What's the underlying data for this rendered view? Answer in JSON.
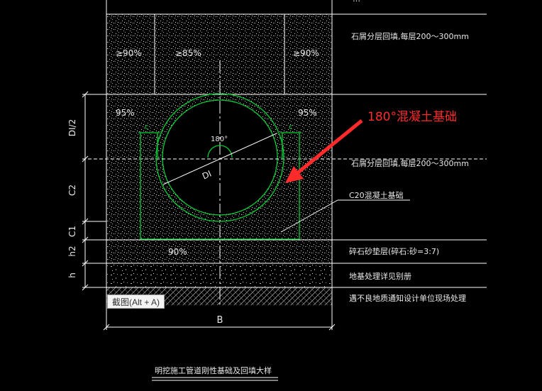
{
  "colors": {
    "background": "#000000",
    "lines": "#ffffff",
    "pipe": "#00cc33",
    "annotation": "#ff2a2a",
    "fill": "#cfcfcf"
  },
  "zones": {
    "upper_left": "≥90%",
    "upper_center": "≥85%",
    "upper_right": "≥90%",
    "pipe_left": "95%",
    "pipe_right": "95%",
    "cushion": "90%"
  },
  "pipe": {
    "angle": "180°",
    "diameter_label": "DI",
    "clearance_left": "c",
    "clearance_right": "c"
  },
  "dimensions": {
    "d_half": "DI/2",
    "c2": "C2",
    "c1": "C1",
    "h2": "h2",
    "h": "h",
    "b": "B"
  },
  "notes": {
    "top_cut": "…",
    "backfill_upper": "石屑分层回填,每层200～300mm",
    "backfill_lower": "石屑分层回填,每层200～300mm",
    "foundation": "C20混凝土基础",
    "cushion": "碎石砂垫层(碎石:砂=3:7)",
    "subgrade": "地基处理详见别册",
    "poor_soil": "遇不良地质通知设计单位现场处理"
  },
  "callout": "180°混凝土基础",
  "drawing_title": "明挖施工管道刚性基础及回填大样",
  "tooltip": "截图(Alt + A)"
}
